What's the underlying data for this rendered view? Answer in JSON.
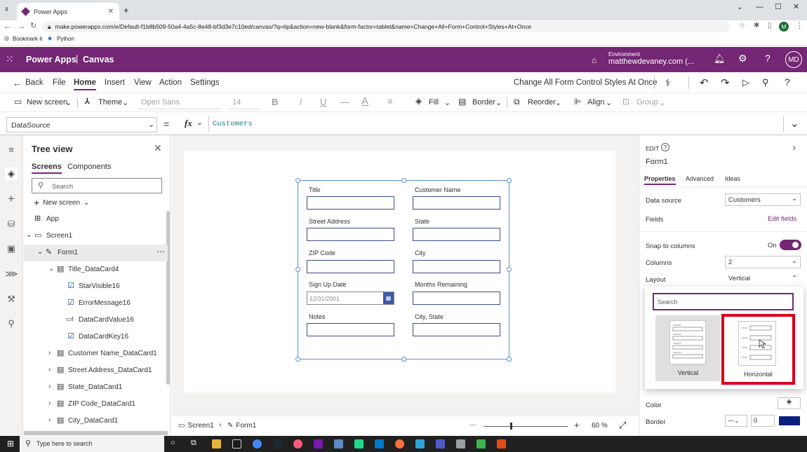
{
  "browser": {
    "tab_title": "Power Apps",
    "url": "make.powerapps.com/e/Default-f1b8b509-50a4-4a5c-8e48-bf3d3e7c10ed/canvas/?q=tip&action=new-blank&form-factor=tablet&name=Change+All+Form+Control+Styles+At+Once",
    "bookmarks": [
      "Bookmark it",
      "Python"
    ],
    "profile_initial": "M"
  },
  "app": {
    "brand": "Power Apps",
    "separator": "|",
    "mode": "Canvas",
    "environment_label": "Environment",
    "environment_value": "matthewdevaney.com (...",
    "avatar": "MD",
    "header_color": "#742774"
  },
  "menu": {
    "back": "Back",
    "items": [
      "File",
      "Home",
      "Insert",
      "View",
      "Action",
      "Settings"
    ],
    "active": "Home",
    "app_name": "Change All Form Control Styles At Once"
  },
  "toolbar": {
    "new_screen": "New screen",
    "theme": "Theme",
    "font": "Open Sans",
    "font_size": "14",
    "bold": "B",
    "italic": "/",
    "underline": "U",
    "strike": "—",
    "font_color": "A",
    "fill": "Fill",
    "border": "Border",
    "reorder": "Reorder",
    "align": "Align",
    "group": "Group"
  },
  "formula": {
    "property": "DataSource",
    "equals": "=",
    "fx": "fx",
    "value": "Customers"
  },
  "tree": {
    "title": "Tree view",
    "tabs": [
      "Screens",
      "Components"
    ],
    "search_placeholder": "Search",
    "new_screen": "New screen",
    "rows": [
      "App",
      "Screen1",
      "Form1",
      "Title_DataCard4",
      "StarVisible16",
      "ErrorMessage16",
      "DataCardValue16",
      "DataCardKey16",
      "Customer Name_DataCard1",
      "Street Address_DataCard1",
      "State_DataCard1",
      "ZIP Code_DataCard1",
      "City_DataCard1"
    ]
  },
  "form": {
    "fields": [
      {
        "label": "Title",
        "value": ""
      },
      {
        "label": "Customer Name",
        "value": ""
      },
      {
        "label": "Street Address",
        "value": ""
      },
      {
        "label": "State",
        "value": ""
      },
      {
        "label": "ZIP Code",
        "value": ""
      },
      {
        "label": "City",
        "value": ""
      },
      {
        "label": "Sign Up Date",
        "value": "12/31/2001"
      },
      {
        "label": "Months Remaining",
        "value": ""
      },
      {
        "label": "Notes",
        "value": ""
      },
      {
        "label": "City, State",
        "value": ""
      }
    ]
  },
  "statusbar": {
    "screen": "Screen1",
    "form": "Form1",
    "zoom_minus": "—",
    "zoom_plus": "+",
    "zoom": "60 %"
  },
  "properties": {
    "edit_label": "EDIT",
    "control": "Form1",
    "tabs": [
      "Properties",
      "Advanced",
      "Ideas"
    ],
    "rows": [
      {
        "label": "Data source",
        "value": "Customers"
      },
      {
        "label": "Fields",
        "value": "Edit fields"
      },
      {
        "label": "Snap to columns",
        "value": "On"
      },
      {
        "label": "Columns",
        "value": "2"
      },
      {
        "label": "Layout",
        "value": "Vertical"
      },
      {
        "label": "Color",
        "value": ""
      },
      {
        "label": "Border",
        "value": "0"
      }
    ],
    "toggle_on": true,
    "border_color": "#0b1f80"
  },
  "layout_popup": {
    "search_placeholder": "Search",
    "options": [
      "Vertical",
      "Horizontal"
    ],
    "highlight_color": "#d6001c"
  },
  "taskbar": {
    "search_placeholder": "Type here to search"
  }
}
